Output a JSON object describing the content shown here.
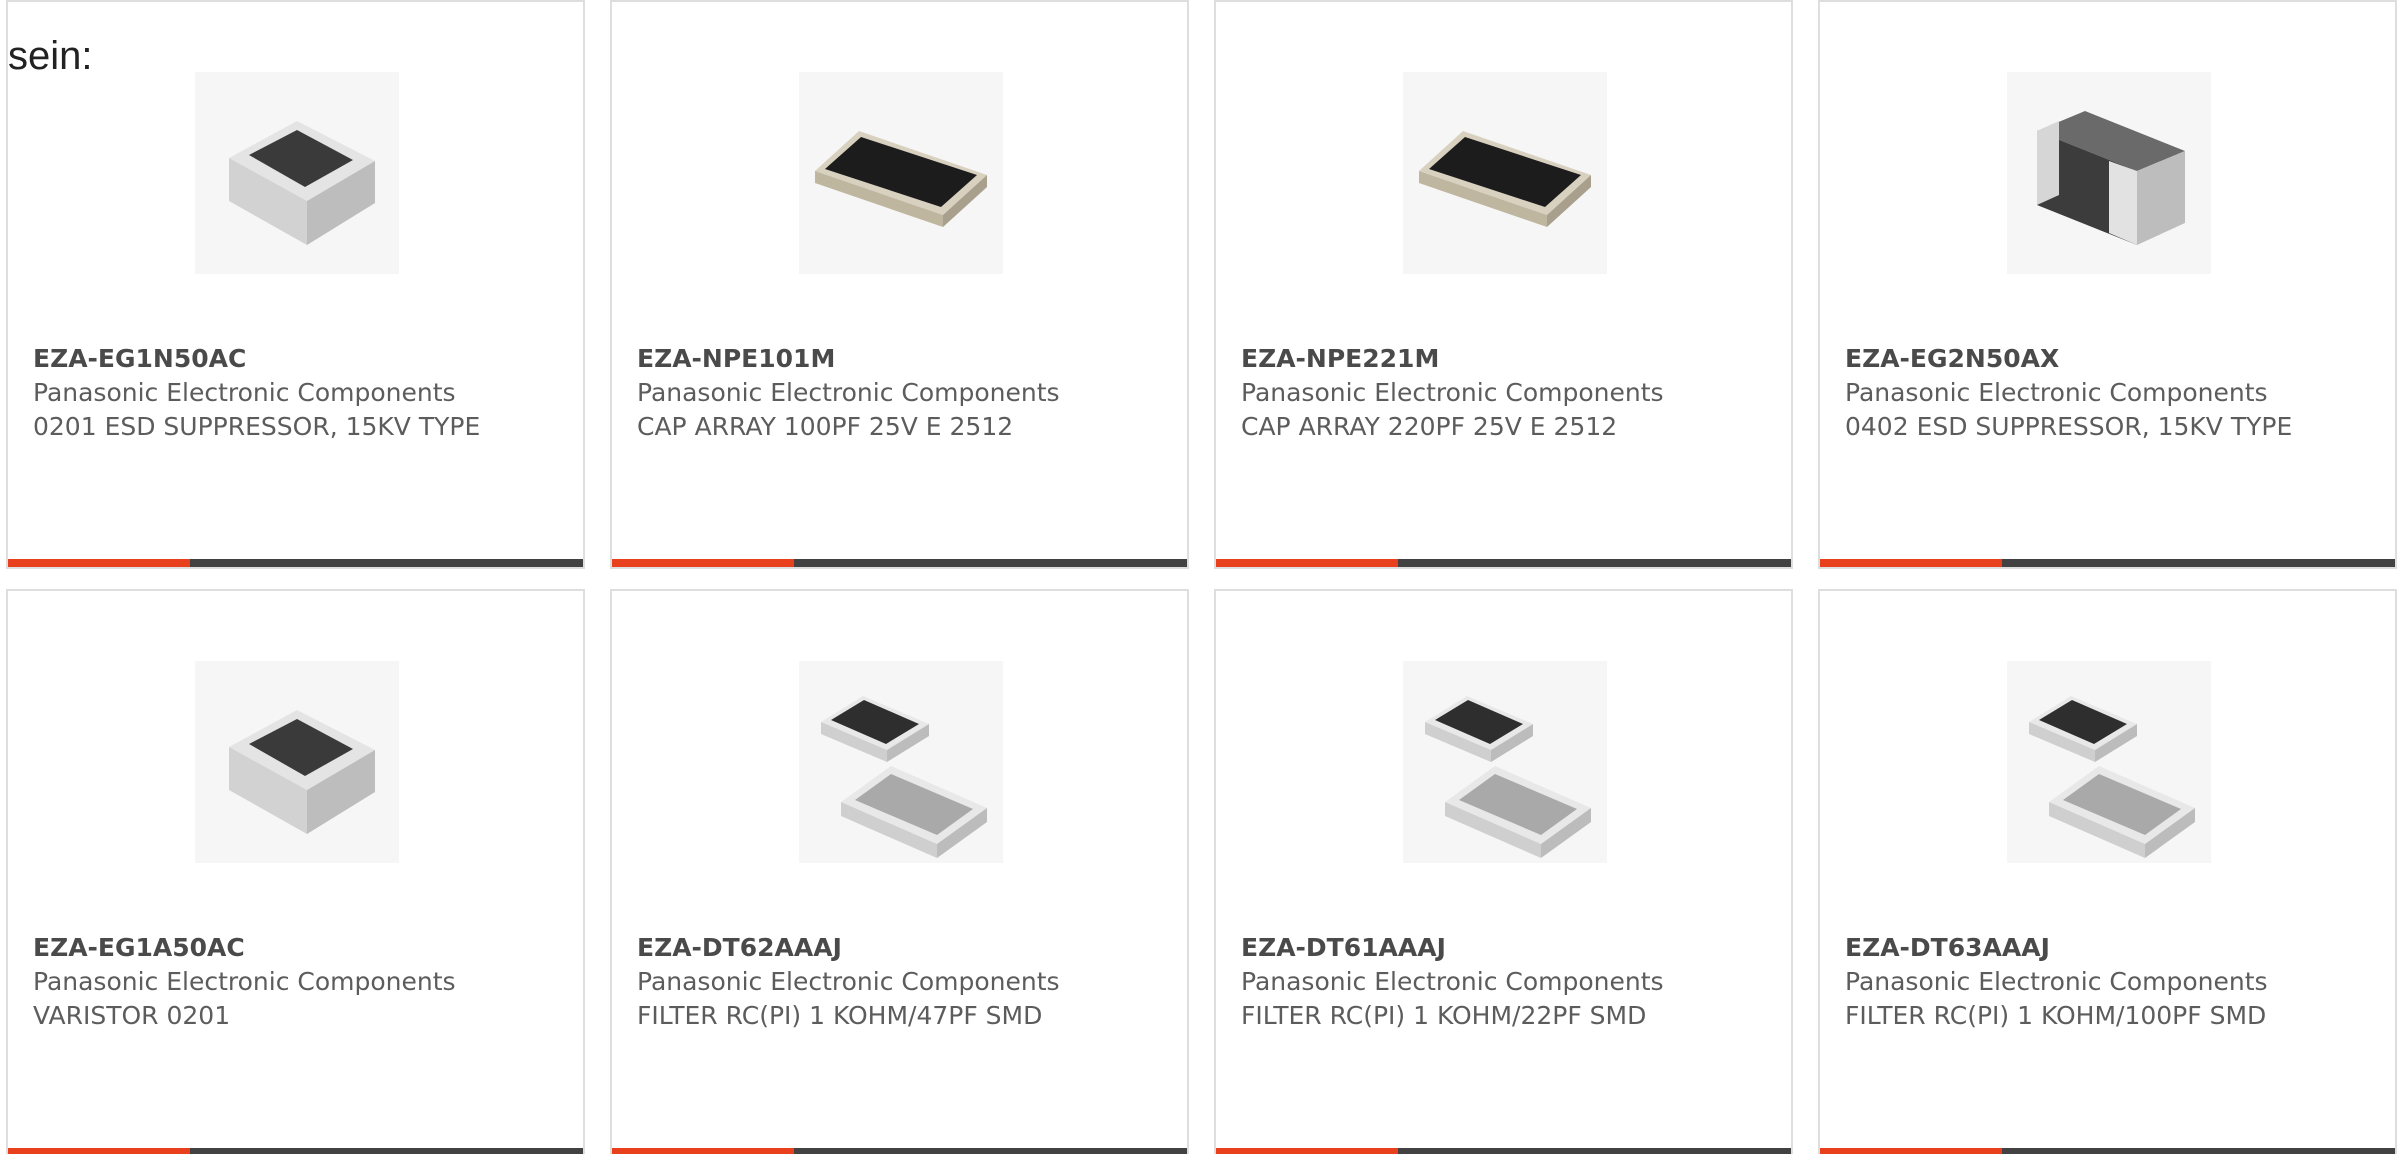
{
  "intro_text": "sein:",
  "accent_color": "#e8401c",
  "bar_color": "#424242",
  "products": [
    {
      "part_number": "EZA-EG1N50AC",
      "manufacturer": "Panasonic Electronic Components",
      "description": "0201 ESD SUPPRESSOR, 15KV TYPE",
      "image": "chip-resistor-icon"
    },
    {
      "part_number": "EZA-NPE101M",
      "manufacturer": "Panasonic Electronic Components",
      "description": "CAP ARRAY 100PF 25V E 2512",
      "image": "capacitor-array-icon"
    },
    {
      "part_number": "EZA-NPE221M",
      "manufacturer": "Panasonic Electronic Components",
      "description": "CAP ARRAY 220PF 25V E 2512",
      "image": "capacitor-array-icon"
    },
    {
      "part_number": "EZA-EG2N50AX",
      "manufacturer": "Panasonic Electronic Components",
      "description": "0402 ESD SUPPRESSOR, 15KV TYPE",
      "image": "chip-capacitor-icon"
    },
    {
      "part_number": "EZA-EG1A50AC",
      "manufacturer": "Panasonic Electronic Components",
      "description": "VARISTOR 0201",
      "image": "chip-resistor-icon"
    },
    {
      "part_number": "EZA-DT62AAAJ",
      "manufacturer": "Panasonic Electronic Components",
      "description": "FILTER RC(PI) 1 KOHM/47PF SMD",
      "image": "filter-array-icon"
    },
    {
      "part_number": "EZA-DT61AAAJ",
      "manufacturer": "Panasonic Electronic Components",
      "description": "FILTER RC(PI) 1 KOHM/22PF SMD",
      "image": "filter-array-icon"
    },
    {
      "part_number": "EZA-DT63AAAJ",
      "manufacturer": "Panasonic Electronic Components",
      "description": "FILTER RC(PI) 1 KOHM/100PF SMD",
      "image": "filter-array-icon"
    }
  ]
}
